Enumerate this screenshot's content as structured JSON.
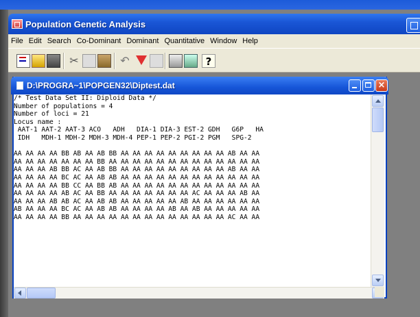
{
  "app": {
    "title": "Population Genetic Analysis"
  },
  "menu": [
    "File",
    "Edit",
    "Search",
    "Co-Dominant",
    "Dominant",
    "Quantitative",
    "Window",
    "Help"
  ],
  "toolbar": {
    "icons": [
      "new-file-icon",
      "open-folder-icon",
      "save-icon",
      "cut-icon",
      "copy-icon",
      "paste-icon",
      "undo-icon",
      "filter-icon",
      "filter-clear-icon",
      "print-icon",
      "calculator-icon",
      "help-icon"
    ],
    "help_label": "?"
  },
  "document": {
    "title": "D:\\PROGRA~1\\POPGEN32\\Diptest.dat",
    "lines": [
      "/* Test Data Set II: Diploid Data */",
      "Number of populations = 4",
      "Number of loci = 21",
      "Locus name :",
      " AAT-1 AAT-2 AAT-3 ACO   ADH   DIA-1 DIA-3 EST-2 GDH   G6P   HA",
      " IDH   MDH-1 MDH-2 MDH-3 MDH-4 PEP-1 PEP-2 PGI-2 PGM   SPG-2",
      "",
      "AA AA AA AA BB AB AA AB BB AA AA AA AA AA AA AA AA AA AB AA AA",
      "AA AA AA AA AA AA AA BB AA AA AA AA AA AA AA AA AA AA AA AA AA",
      "AA AA AA AB BB AC AA AB BB AA AA AA AA AA AA AA AA AA AB AA AA",
      "AA AA AA AA BC AC AA AB AB AA AA AA AA AA AA AA AA AA AA AA AA",
      "AA AA AA AA BB CC AA BB AB AA AA AA AA AA AA AA AA AA AA AA AA",
      "AA AA AA AA AB AC AA BB AA AA AA AA AA AA AA AC AA AA AA AB AA",
      "AA AA AA AB AB AC AA AB AB AA AA AA AA AA AB AA AA AA AA AA AA",
      "AB AA AA AA BC AC AA AB AB AA AA AA AA AB AA AB AA AA AA AA AA",
      "AA AA AA AA BB AA AA AA AA AA AA AA AA AA AA AA AA AA AC AA AA"
    ]
  },
  "window_buttons": {
    "close_label": "×"
  },
  "colors": {
    "titlebar": "#1a56d6",
    "menubar": "#ece9d8",
    "close": "#c83a1a"
  }
}
